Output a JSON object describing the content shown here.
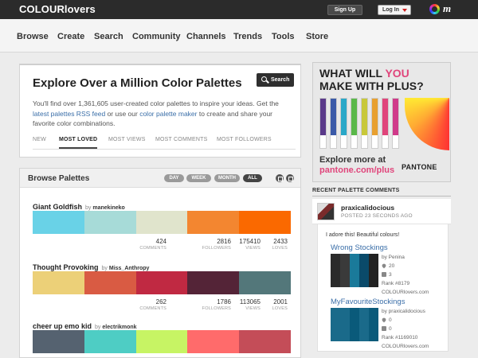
{
  "app": {
    "logo": "COLOURlovers",
    "signup": "Sign Up",
    "login": "Log In",
    "cl_mark": "m"
  },
  "nav": [
    "Browse",
    "Create",
    "Search",
    "Community",
    "Channels",
    "Trends",
    "Tools",
    "Store"
  ],
  "search_panel": {
    "title": "Explore Over a Million Color Palettes",
    "button": "Search",
    "desc_1": "You'll find over 1,361,605 user-created color palettes to inspire your ideas. Get the ",
    "link_1": "latest palettes RSS feed",
    "desc_2": " or use our ",
    "link_2": "color palette maker",
    "desc_3": " to create and share your favorite color combinations.",
    "tabs": [
      "NEW",
      "MOST LOVED",
      "MOST VIEWS",
      "MOST COMMENTS",
      "MOST FOLLOWERS"
    ],
    "active_tab": "MOST LOVED"
  },
  "browse": {
    "title": "Browse Palettes",
    "periods": [
      "DAY",
      "WEEK",
      "MONTH",
      "ALL"
    ],
    "active_period": "ALL",
    "palettes": [
      {
        "name": "Giant Goldfish",
        "by": "by",
        "author": "manekineko",
        "colors": [
          "#69D2E7",
          "#A7DBD8",
          "#E0E4CC",
          "#F38630",
          "#FA6900"
        ],
        "comments": "424",
        "followers": "2816",
        "views": "175410",
        "loves": "2433"
      },
      {
        "name": "Thought Provoking",
        "by": "by",
        "author": "Miss_Anthropy",
        "colors": [
          "#ECD078",
          "#D95B43",
          "#C02942",
          "#542437",
          "#53777A"
        ],
        "comments": "262",
        "followers": "1786",
        "views": "113065",
        "loves": "2001"
      },
      {
        "name": "cheer up emo kid",
        "by": "by",
        "author": "electrikmonk",
        "colors": [
          "#556270",
          "#4ECDC4",
          "#C7F464",
          "#FF6B6B",
          "#C44D58"
        ],
        "comments": "",
        "followers": "",
        "views": "",
        "loves": ""
      }
    ],
    "stat_labels": {
      "comments": "COMMENTS",
      "followers": "FOLLOWERS",
      "views": "VIEWS",
      "loves": "LOVES"
    }
  },
  "ad": {
    "line1_a": "WHAT WILL ",
    "line1_you": "YOU",
    "line2": "MAKE WITH PLUS?",
    "cta": "Explore more at",
    "url": "pantone.com/plus",
    "brand": "PANTONE",
    "chip_colors": [
      "#5a3a8a",
      "#3a5aa8",
      "#2aa8c8",
      "#5ab84a",
      "#c8c83a",
      "#e8a030",
      "#e0457b",
      "#d03a8a"
    ]
  },
  "recent": {
    "title": "RECENT PALETTE COMMENTS",
    "user": "praxicalidocious",
    "time": "POSTED 23 SECONDS AGO",
    "comment": "I adore this! Beautiful colours!",
    "items": [
      {
        "title": "Wrong Stockings",
        "by": "by Penina",
        "loves": "20",
        "comments": "3",
        "rank": "Rank #8179",
        "site": "COLOURlovers.com",
        "colors": [
          "#2b2b2b",
          "#3a3a3a",
          "#1a7a9a",
          "#0a4a6a",
          "#222222"
        ]
      },
      {
        "title": "MyFavouriteStockings",
        "by": "by praxicalidocious",
        "loves": "0",
        "comments": "0",
        "rank": "Rank #1169010",
        "site": "COLOURlovers.com",
        "colors": [
          "#1a6a8a",
          "#1a6a8a",
          "#0a5a7a",
          "#1a6a8a",
          "#0a5a7a"
        ]
      }
    ]
  }
}
